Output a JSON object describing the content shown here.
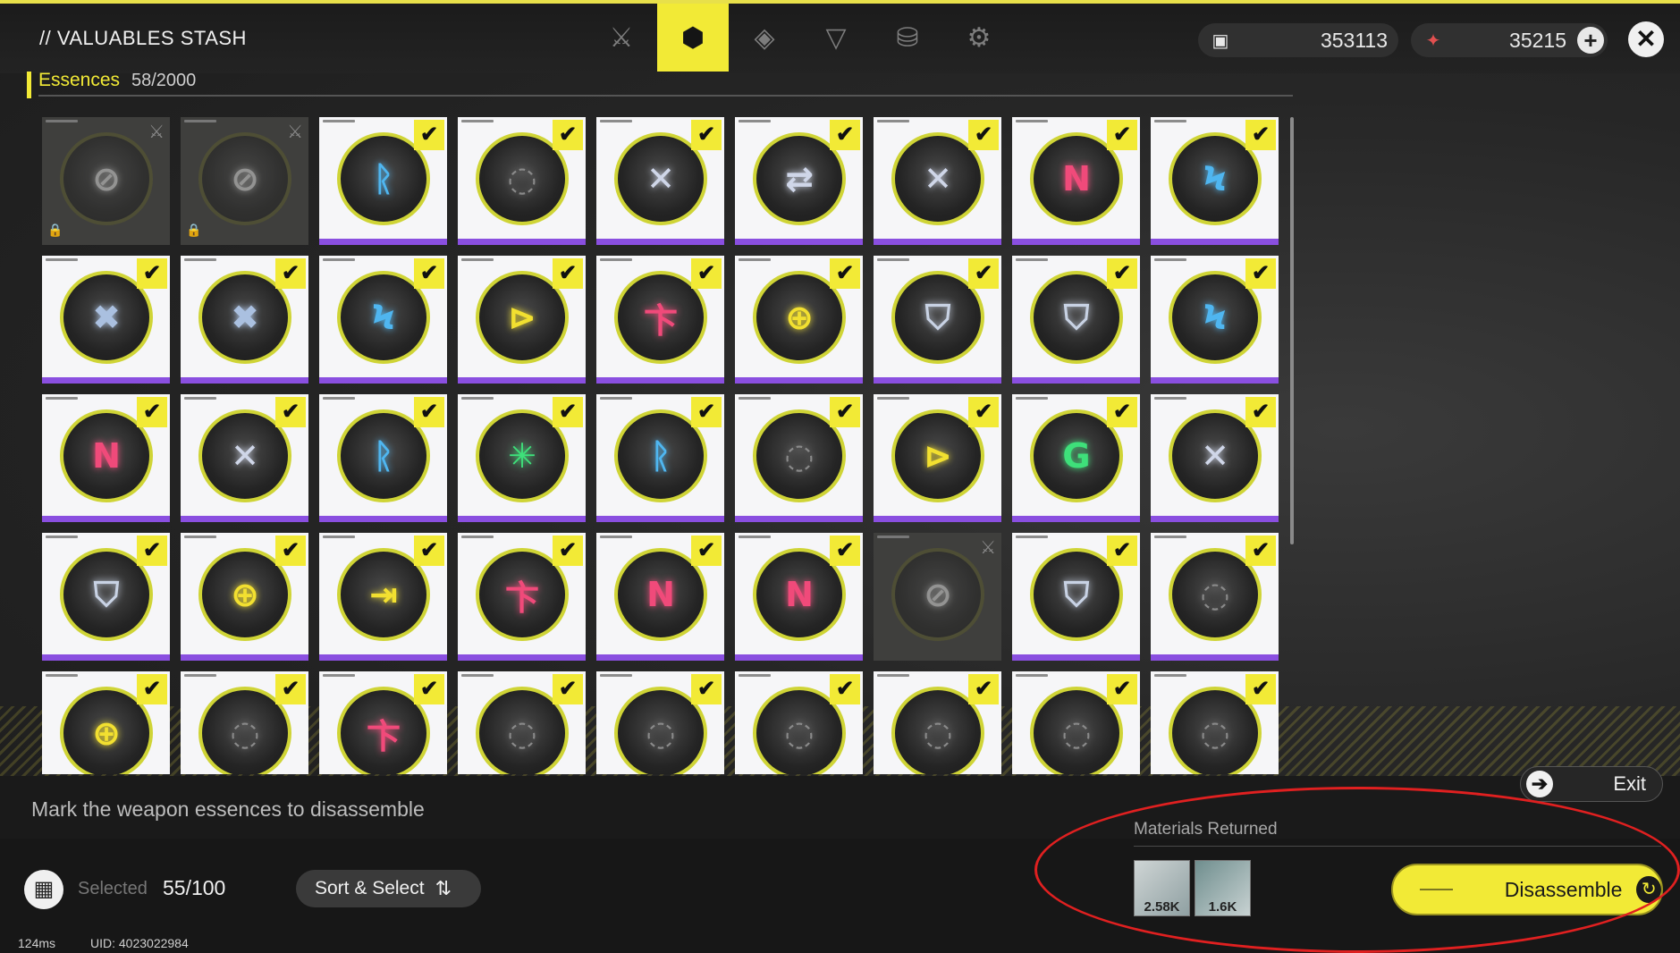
{
  "header": {
    "title": "// VALUABLES STASH",
    "tabs": [
      {
        "icon": "sword-slash-icon",
        "glyph": "⚔",
        "active": false
      },
      {
        "icon": "cube-icon",
        "glyph": "⬢",
        "active": true
      },
      {
        "icon": "diamond-icon",
        "glyph": "◈",
        "active": false
      },
      {
        "icon": "triangle-icon",
        "glyph": "▽",
        "active": false
      },
      {
        "icon": "chest-icon",
        "glyph": "⛁",
        "active": false
      },
      {
        "icon": "gear-icon",
        "glyph": "⚙",
        "active": false
      }
    ],
    "currencies": [
      {
        "icon": "ticket-icon",
        "glyph": "▣",
        "value": "353113"
      },
      {
        "icon": "red-crystal-icon",
        "glyph": "✦",
        "value": "35215"
      }
    ],
    "plus_glyph": "+",
    "close_glyph": "✕"
  },
  "category": {
    "name": "Essences",
    "count": "58/2000"
  },
  "colors": {
    "accent": "#f2ea36",
    "rarity": "#8a4fe0",
    "annotation": "#e02020"
  },
  "grid": {
    "rows": [
      [
        {
          "glyph": "⊘",
          "color": "#d8d8d8",
          "locked": true,
          "checked": false
        },
        {
          "glyph": "⊘",
          "color": "#d8d8d8",
          "locked": true,
          "checked": false
        },
        {
          "glyph": "ᚱ",
          "color": "#4fb6f0",
          "locked": false,
          "checked": true
        },
        {
          "glyph": "◌",
          "color": "#8a8a8a",
          "locked": false,
          "checked": true
        },
        {
          "glyph": "✕",
          "color": "#cfd6e8",
          "locked": false,
          "checked": true
        },
        {
          "glyph": "⇄",
          "color": "#cfd6e8",
          "locked": false,
          "checked": true
        },
        {
          "glyph": "✕",
          "color": "#cfd6e8",
          "locked": false,
          "checked": true
        },
        {
          "glyph": "N",
          "color": "#f04a7a",
          "locked": false,
          "checked": true
        },
        {
          "glyph": "Ϟ",
          "color": "#4fb6f0",
          "locked": false,
          "checked": true
        }
      ],
      [
        {
          "glyph": "✖",
          "color": "#aac0e0",
          "locked": false,
          "checked": true
        },
        {
          "glyph": "✖",
          "color": "#aac0e0",
          "locked": false,
          "checked": true
        },
        {
          "glyph": "Ϟ",
          "color": "#4fb6f0",
          "locked": false,
          "checked": true
        },
        {
          "glyph": "⊳",
          "color": "#f2e030",
          "locked": false,
          "checked": true
        },
        {
          "glyph": "卞",
          "color": "#f04a7a",
          "locked": false,
          "checked": true
        },
        {
          "glyph": "⊕",
          "color": "#f2e030",
          "locked": false,
          "checked": true
        },
        {
          "glyph": "⛉",
          "color": "#c8d2e4",
          "locked": false,
          "checked": true
        },
        {
          "glyph": "⛉",
          "color": "#c8d2e4",
          "locked": false,
          "checked": true
        },
        {
          "glyph": "Ϟ",
          "color": "#4fb6f0",
          "locked": false,
          "checked": true
        }
      ],
      [
        {
          "glyph": "N",
          "color": "#f04a7a",
          "locked": false,
          "checked": true
        },
        {
          "glyph": "✕",
          "color": "#cfd6e8",
          "locked": false,
          "checked": true
        },
        {
          "glyph": "ᚱ",
          "color": "#4fb6f0",
          "locked": false,
          "checked": true
        },
        {
          "glyph": "✳",
          "color": "#3ee07a",
          "locked": false,
          "checked": true
        },
        {
          "glyph": "ᚱ",
          "color": "#4fb6f0",
          "locked": false,
          "checked": true
        },
        {
          "glyph": "◌",
          "color": "#8a8a8a",
          "locked": false,
          "checked": true
        },
        {
          "glyph": "⊳",
          "color": "#f2e030",
          "locked": false,
          "checked": true
        },
        {
          "glyph": "G",
          "color": "#3ee07a",
          "locked": false,
          "checked": true
        },
        {
          "glyph": "✕",
          "color": "#cfd6e8",
          "locked": false,
          "checked": true
        }
      ],
      [
        {
          "glyph": "⛉",
          "color": "#c8d2e4",
          "locked": false,
          "checked": true
        },
        {
          "glyph": "⊕",
          "color": "#f2e030",
          "locked": false,
          "checked": true
        },
        {
          "glyph": "⇥",
          "color": "#f2e030",
          "locked": false,
          "checked": true
        },
        {
          "glyph": "卞",
          "color": "#f04a7a",
          "locked": false,
          "checked": true
        },
        {
          "glyph": "N",
          "color": "#f04a7a",
          "locked": false,
          "checked": true
        },
        {
          "glyph": "N",
          "color": "#f04a7a",
          "locked": false,
          "checked": true
        },
        {
          "glyph": "⊘",
          "color": "#d8d8d8",
          "locked": true,
          "checked": false
        },
        {
          "glyph": "⛉",
          "color": "#c8d2e4",
          "locked": false,
          "checked": true
        },
        {
          "glyph": "◌",
          "color": "#8a8a8a",
          "locked": false,
          "checked": true
        }
      ],
      [
        {
          "glyph": "⊕",
          "color": "#f2e030",
          "locked": false,
          "checked": true
        },
        {
          "glyph": "◌",
          "color": "#8a8a8a",
          "locked": false,
          "checked": true
        },
        {
          "glyph": "卞",
          "color": "#f04a7a",
          "locked": false,
          "checked": true
        },
        {
          "glyph": "◌",
          "color": "#8a8a8a",
          "locked": false,
          "checked": true
        },
        {
          "glyph": "◌",
          "color": "#8a8a8a",
          "locked": false,
          "checked": true
        },
        {
          "glyph": "◌",
          "color": "#8a8a8a",
          "locked": false,
          "checked": true
        },
        {
          "glyph": "◌",
          "color": "#8a8a8a",
          "locked": false,
          "checked": true
        },
        {
          "glyph": "◌",
          "color": "#8a8a8a",
          "locked": false,
          "checked": true
        },
        {
          "glyph": "◌",
          "color": "#8a8a8a",
          "locked": false,
          "checked": true
        }
      ]
    ],
    "check_glyph": "✔",
    "lock_glyph": "🔒",
    "sword_glyph": "⚔"
  },
  "hint": "Mark the weapon essences to disassemble",
  "exit": {
    "label": "Exit",
    "icon_glyph": "➔"
  },
  "selection": {
    "label": "Selected",
    "count": "55/100",
    "icon_glyph": "▦"
  },
  "sort": {
    "label": "Sort & Select",
    "icon_glyph": "⇅"
  },
  "status": {
    "ping": "124ms",
    "uid": "UID: 4023022984"
  },
  "materials": {
    "label": "Materials Returned",
    "items": [
      {
        "name": "material-1",
        "value": "2.58K"
      },
      {
        "name": "material-2",
        "value": "1.6K"
      }
    ]
  },
  "disassemble": {
    "label": "Disassemble",
    "icon_glyph": "↻"
  }
}
